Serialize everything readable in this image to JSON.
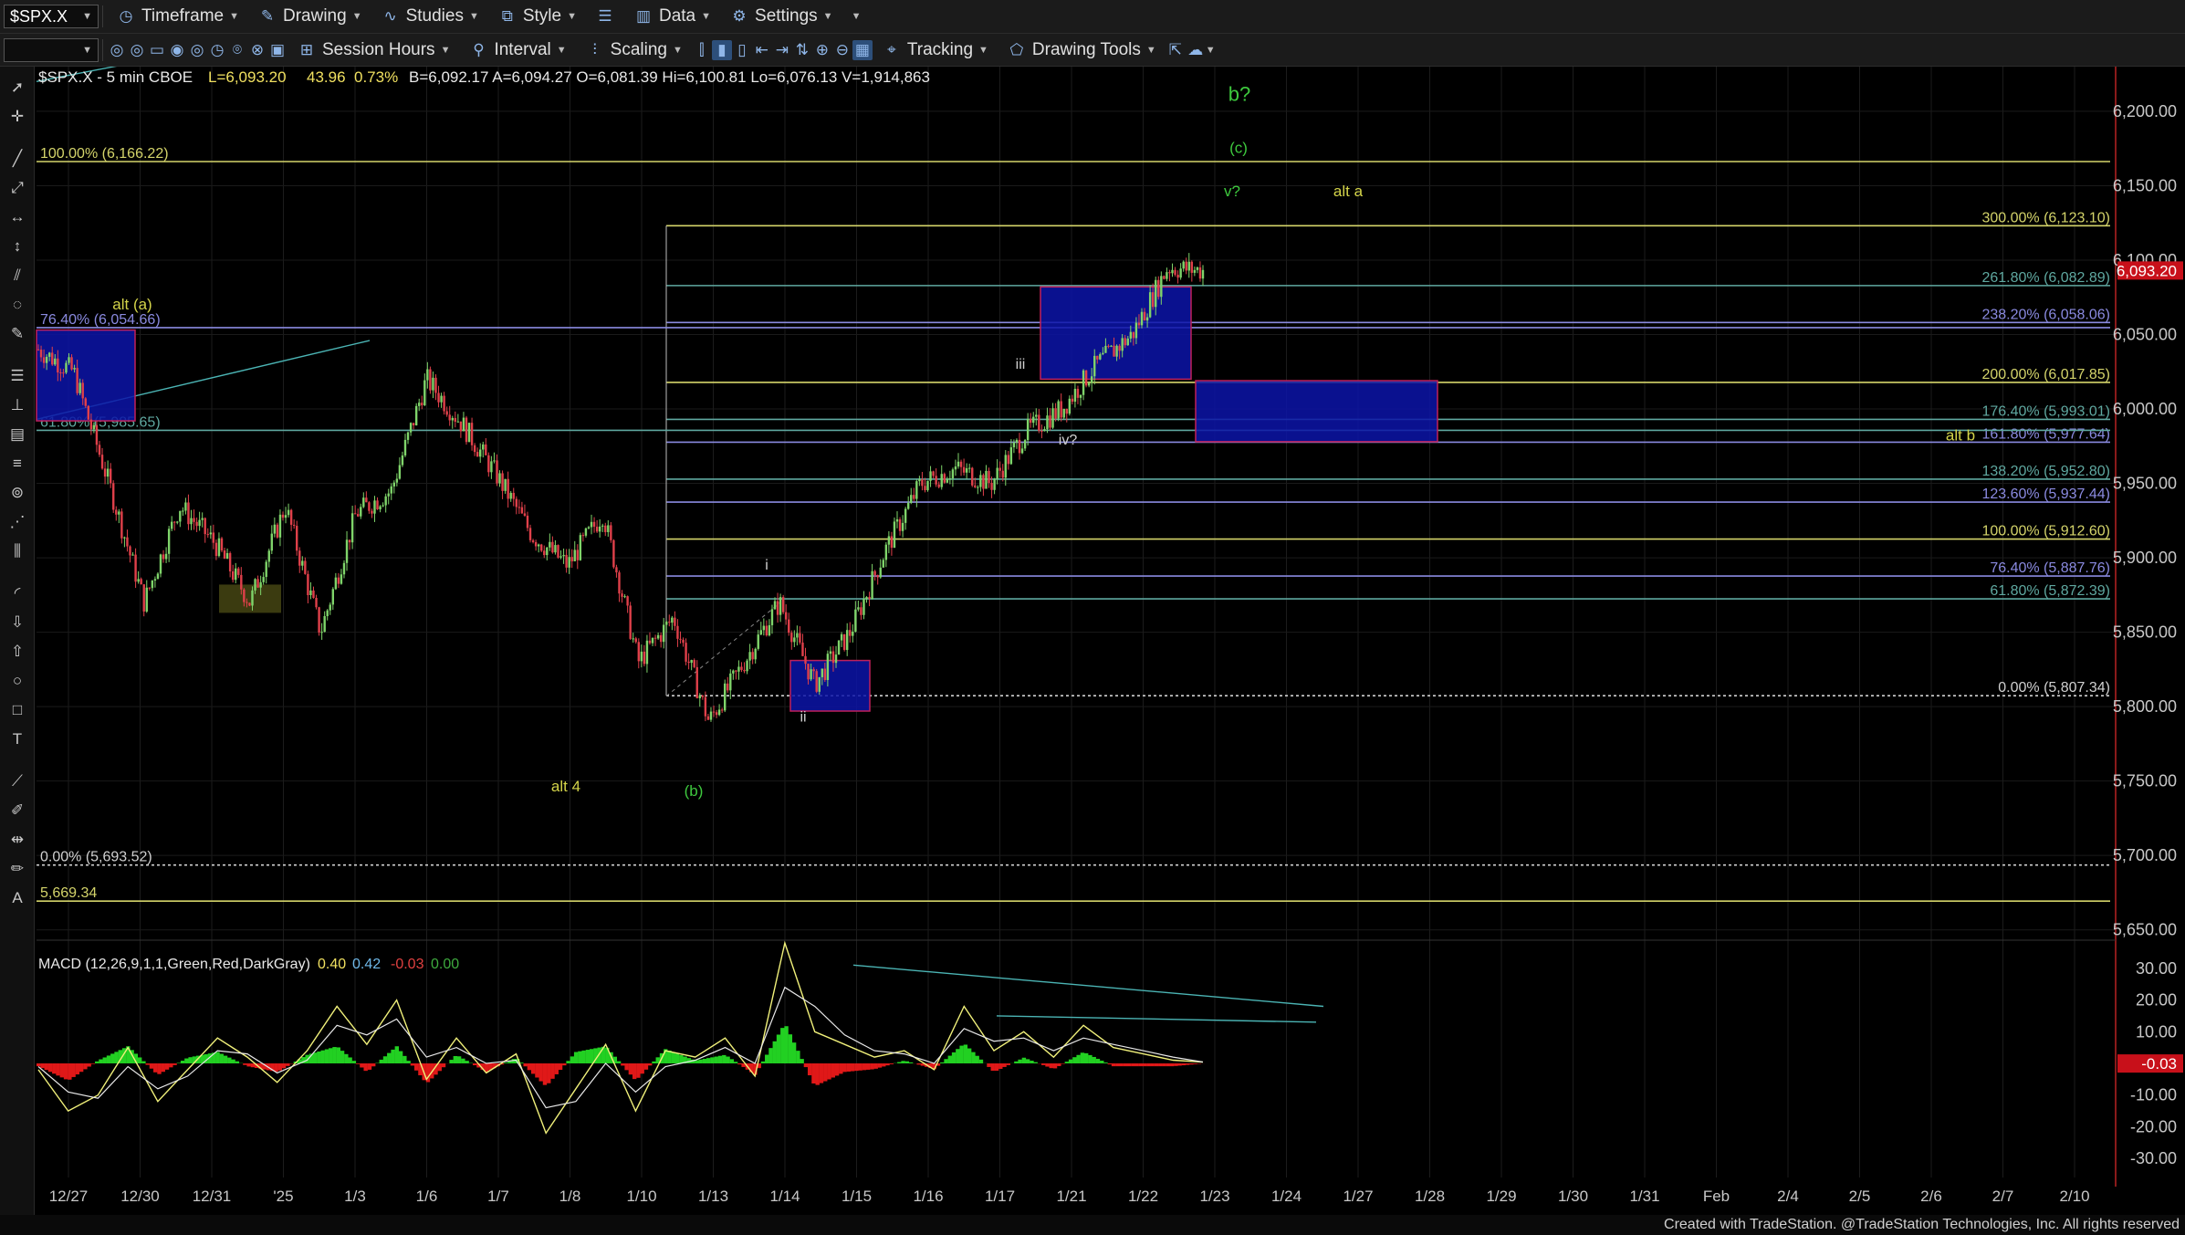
{
  "toolbar": {
    "symbol": "$SPX.X",
    "menus": [
      "Timeframe",
      "Drawing",
      "Studies",
      "Style",
      "Data",
      "Settings"
    ],
    "row2": [
      "Session Hours",
      "Interval",
      "Scaling",
      "Tracking",
      "Drawing Tools"
    ]
  },
  "header": {
    "symbol_line": "$SPX.X - 5 min  CBOE",
    "last": "L=6,093.20",
    "change": "43.96",
    "pct": "0.73%",
    "rest": "B=6,092.17  A=6,094.27  O=6,081.39  Hi=6,100.81  Lo=6,076.13  V=1,914,863"
  },
  "footer": "Created with TradeStation. @TradeStation Technologies, Inc. All rights reserved",
  "chart_data": [
    {
      "type": "line",
      "subtype": "candlestick",
      "series": [
        {
          "name": "$SPX.X - 5 min",
          "values": [
            6040,
            6025,
            5950,
            5870,
            5935,
            5910,
            5870,
            5935,
            5850,
            5930,
            5945,
            6020,
            5990,
            5955,
            5915,
            5895,
            5930,
            5830,
            5860,
            5790,
            5830,
            5870,
            5815,
            5850,
            5905,
            5950,
            5960,
            5950,
            5985,
            6000,
            6030,
            6050,
            6095,
            6093
          ]
        }
      ],
      "y_axis": {
        "ticks": [
          "6,200.00",
          "6,150.00",
          "6,100.00",
          "6,050.00",
          "6,000.00",
          "5,950.00",
          "5,900.00",
          "5,850.00",
          "5,800.00",
          "5,750.00",
          "5,700.00",
          "5,650.00"
        ],
        "ylim": [
          5640,
          6230
        ]
      },
      "x_axis": {
        "ticks": [
          "12/27",
          "12/30",
          "12/31",
          "'25",
          "1/3",
          "1/6",
          "1/7",
          "1/8",
          "1/10",
          "1/13",
          "1/14",
          "1/15",
          "1/16",
          "1/17",
          "1/21",
          "1/22",
          "1/23",
          "1/24",
          "1/27",
          "1/28",
          "1/29",
          "1/30",
          "1/31",
          "Feb",
          "2/4",
          "2/5",
          "2/6",
          "2/7",
          "2/10"
        ]
      },
      "last_price_label": "6,093.20",
      "fib_levels_right": [
        {
          "label": "300.00% (6,123.10)",
          "value": 6123.1,
          "color": "#d4d46a"
        },
        {
          "label": "261.80% (6,082.89)",
          "value": 6082.89,
          "color": "#5fa8a0"
        },
        {
          "label": "238.20% (6,058.06)",
          "value": 6058.06,
          "color": "#8a8ae0"
        },
        {
          "label": "200.00% (6,017.85)",
          "value": 6017.85,
          "color": "#d4d46a"
        },
        {
          "label": "176.40% (5,993.01)",
          "value": 5993.01,
          "color": "#5fa8a0"
        },
        {
          "label": "161.80% (5,977.64)",
          "value": 5977.64,
          "color": "#8a8ae0"
        },
        {
          "label": "138.20% (5,952.80)",
          "value": 5952.8,
          "color": "#5fa8a0"
        },
        {
          "label": "123.60% (5,937.44)",
          "value": 5937.44,
          "color": "#8a8ae0"
        },
        {
          "label": "100.00% (5,912.60)",
          "value": 5912.6,
          "color": "#d4d46a"
        },
        {
          "label": "76.40% (5,887.76)",
          "value": 5887.76,
          "color": "#8a8ae0"
        },
        {
          "label": "61.80% (5,872.39)",
          "value": 5872.39,
          "color": "#5fa8a0"
        },
        {
          "label": "0.00% (5,807.34)",
          "value": 5807.34,
          "color": "#d0d0d0"
        }
      ],
      "fib_levels_left": [
        {
          "label": "100.00% (6,166.22)",
          "value": 6166.22,
          "color": "#d4d46a"
        },
        {
          "label": "76.40% (6,054.66)",
          "value": 6054.66,
          "color": "#8a8ae0"
        },
        {
          "label": "61.80% (5,985.65)",
          "value": 5985.65,
          "color": "#5fa8a0"
        },
        {
          "label": "0.00% (5,693.52)",
          "value": 5693.52,
          "color": "#d0d0d0"
        },
        {
          "label": "5,669.34",
          "value": 5669.34,
          "color": "#d4d46a"
        }
      ],
      "wave_labels": [
        {
          "text": "b?",
          "color": "#3ec93e"
        },
        {
          "text": "(c)",
          "color": "#3ec93e"
        },
        {
          "text": "v?",
          "color": "#3ec93e"
        },
        {
          "text": "alt a",
          "color": "#d4d44a"
        },
        {
          "text": "alt (a)",
          "color": "#d4d44a"
        },
        {
          "text": "alt b",
          "color": "#d4d44a"
        },
        {
          "text": "alt 4",
          "color": "#d4d44a"
        },
        {
          "text": "(b)",
          "color": "#3ec93e"
        },
        {
          "text": "i",
          "color": "#d0d0d0"
        },
        {
          "text": "ii",
          "color": "#d0d0d0"
        },
        {
          "text": "iii",
          "color": "#d0d0d0"
        },
        {
          "text": "iv?",
          "color": "#d0d0d0"
        }
      ]
    },
    {
      "type": "line",
      "subtype": "macd",
      "legend": {
        "name": "MACD (12,26,9,1,1,Green,Red,DarkGray)",
        "v1": "0.40",
        "v2": "0.42",
        "v3": "-0.03",
        "v4": "0.00"
      },
      "y_axis": {
        "ticks": [
          "30.00",
          "20.00",
          "10.00",
          "0.00",
          "-10.00",
          "-20.00",
          "-30.00"
        ],
        "ylim": [
          -36,
          36
        ]
      },
      "last_value_label": "-0.03",
      "series": [
        {
          "name": "MACD",
          "values": [
            -2,
            -15,
            -10,
            5,
            -12,
            -2,
            8,
            2,
            -6,
            4,
            18,
            6,
            20,
            -5,
            8,
            -3,
            3,
            -22,
            -8,
            6,
            -15,
            4,
            2,
            8,
            -4,
            38,
            10,
            6,
            2,
            4,
            -2,
            18,
            4,
            10,
            2,
            12,
            5,
            3,
            1,
            0.4
          ]
        },
        {
          "name": "Signal",
          "values": [
            -1,
            -9,
            -11,
            -1,
            -8,
            -4,
            4,
            3,
            -3,
            1,
            12,
            9,
            14,
            2,
            5,
            0,
            1,
            -14,
            -12,
            0,
            -9,
            -1,
            1,
            5,
            0,
            24,
            18,
            9,
            4,
            3,
            0,
            11,
            7,
            8,
            4,
            8,
            6,
            4,
            2,
            0.42
          ]
        }
      ]
    }
  ]
}
